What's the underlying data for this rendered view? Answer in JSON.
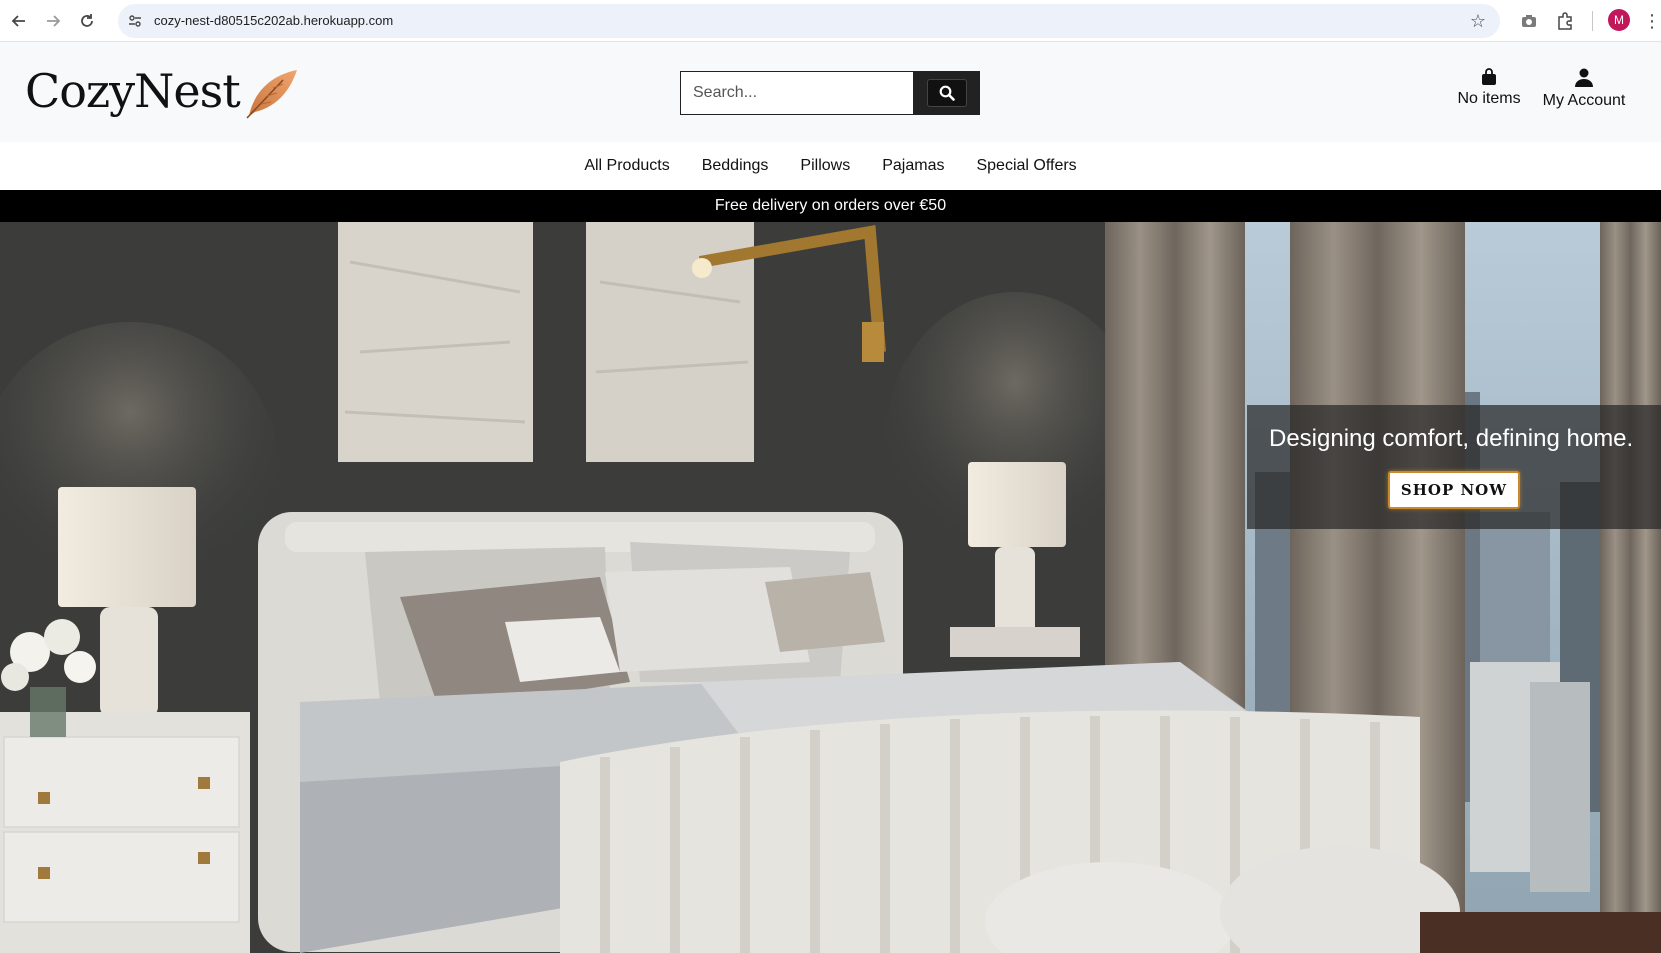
{
  "browser": {
    "url": "cozy-nest-d80515c202ab.herokuapp.com",
    "profile_initial": "M"
  },
  "header": {
    "logo_text": "CozyNest",
    "search_placeholder": "Search...",
    "cart_label": "No items",
    "account_label": "My Account"
  },
  "nav": {
    "items": [
      "All Products",
      "Beddings",
      "Pillows",
      "Pajamas",
      "Special Offers"
    ]
  },
  "promo": {
    "text": "Free delivery on orders over €50"
  },
  "hero": {
    "tagline": "Designing comfort, defining home.",
    "cta_label": "SHOP NOW"
  },
  "colors": {
    "accent_feather": "#d9895a",
    "button_border": "#c98a2b",
    "promo_bg": "#000000",
    "header_bg": "#f8f9fa"
  }
}
